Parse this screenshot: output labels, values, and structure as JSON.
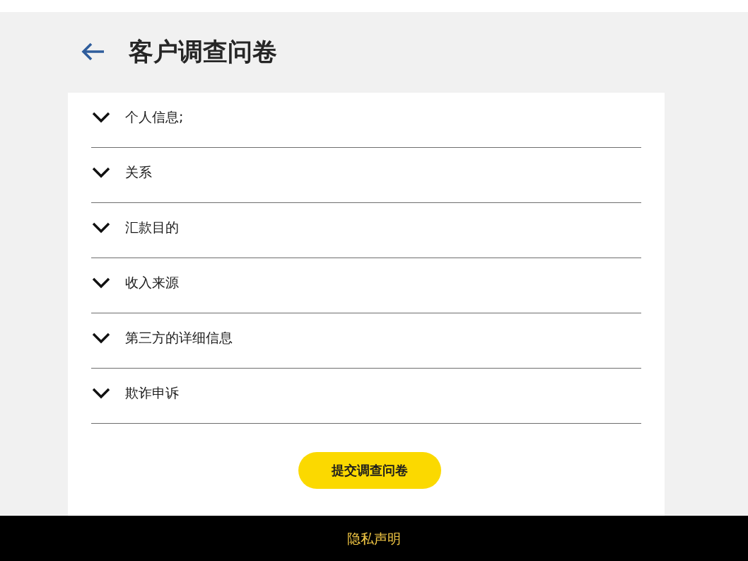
{
  "header": {
    "title": "客户调查问卷"
  },
  "sections": [
    {
      "label": "个人信息;",
      "expanded": false
    },
    {
      "label": "关系",
      "expanded": false
    },
    {
      "label": "汇款目的",
      "expanded": false
    },
    {
      "label": "收入来源",
      "expanded": false
    },
    {
      "label": "第三方的详细信息",
      "expanded": false
    },
    {
      "label": "欺诈申诉",
      "expanded": false
    }
  ],
  "submit_button": {
    "label": "提交调查问卷"
  },
  "footer": {
    "link": "隐私声明"
  }
}
